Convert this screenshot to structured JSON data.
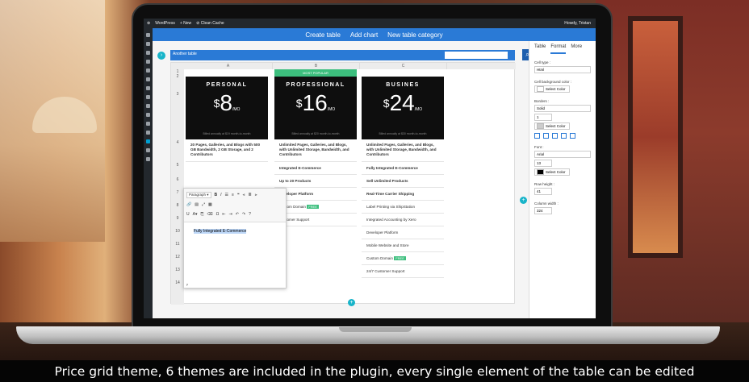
{
  "admin_bar": {
    "site": "WordPress",
    "new": "New",
    "cache": "Clean Cache",
    "greeting": "Howdy, Tristan"
  },
  "top_nav": {
    "create_table": "Create table",
    "add_chart": "Add chart",
    "new_category": "New table category"
  },
  "editor": {
    "table_name": "Another table",
    "columns": [
      "A",
      "B",
      "C"
    ],
    "rows": [
      "1",
      "2",
      "3",
      "4",
      "5",
      "6",
      "7",
      "8",
      "9",
      "10",
      "11",
      "12",
      "13",
      "14"
    ]
  },
  "pricing": {
    "most_popular": "MOST POPULAR",
    "plans": [
      {
        "name": "PERSONAL",
        "currency": "$",
        "price": "8",
        "period": "/MO",
        "billed": "Billed annually at $19 month-to-month",
        "description": "20 Pages, Galleries, and Blogs with 500 GB Bandwidth, 2 GB Storage, and 2 Contributors",
        "features": []
      },
      {
        "name": "PROFESSIONAL",
        "currency": "$",
        "price": "16",
        "period": "/MO",
        "billed": "Billed annually at $20 month-to-month",
        "description": "Unlimited Pages, Galleries, and Blogs, with Unlimited Storage, Bandwidth, and Contributors",
        "features": [
          "Integrated E-Commerce",
          "Up to 20 Products",
          "Developer Platform",
          "Custom Domain",
          "Customer Support"
        ]
      },
      {
        "name": "BUSINES",
        "currency": "$",
        "price": "24",
        "period": "/MO",
        "billed": "Billed annually at $30 month-to-month",
        "description": "Unlimited Pages, Galleries, and Blogs, with Unlimited Storage, Bandwidth, and Contributors",
        "features": [
          "Fully Integrated E-Commerce",
          "Sell Unlimited Products",
          "Real-Time Carrier Shipping",
          "Label Printing via ShipStation",
          "Integrated Accounting by Xero",
          "Developer Platform",
          "Mobile Website and Store",
          "Custom Domain",
          "24/7 Customer Support"
        ]
      }
    ],
    "free_badge": "FREE"
  },
  "text_editor": {
    "format_select": "Paragraph",
    "content": "Fully Integrated E-Commerce",
    "status": "p"
  },
  "right_panel": {
    "tabs": [
      "Table",
      "Format",
      "More"
    ],
    "active_tab": "Format",
    "cell_type_label": "Cell type :",
    "cell_type_value": "Html",
    "cell_bg_label": "Cell background color :",
    "select_color": "Select Color",
    "borders_label": "Borders :",
    "borders_value": "Solid",
    "border_width": "1",
    "font_label": "Font :",
    "font_value": "Arial",
    "font_size": "13",
    "row_height_label": "Row height :",
    "row_height": "41",
    "column_width_label": "Column width :",
    "column_width": "324",
    "accent": "#2a7ad6"
  },
  "caption": "Price grid  theme, 6 themes are included in the plugin, every single element of the table can be edited"
}
